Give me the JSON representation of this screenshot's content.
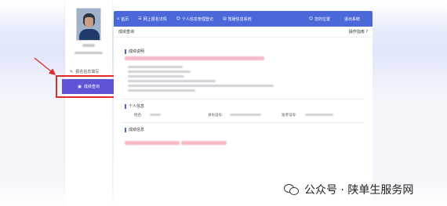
{
  "nav": {
    "items": [
      {
        "icon": "home-icon",
        "glyph": "⌂",
        "label": "首页"
      },
      {
        "icon": "list-icon",
        "glyph": "☰",
        "label": "网上报名详情"
      },
      {
        "icon": "user-icon",
        "glyph": "☺",
        "label": "个人信息管理登记"
      },
      {
        "icon": "doc-icon",
        "glyph": "▤",
        "label": "暂缓信息系统"
      }
    ],
    "right_items": [
      {
        "icon": "person-icon",
        "glyph": "☺",
        "label": "您的位置"
      },
      {
        "label": "退出系统"
      }
    ]
  },
  "sidebar": {
    "link_label": "报名信息填写",
    "active_label": "成绩查询"
  },
  "content": {
    "title": "成绩查询",
    "help": "操作指南 ?",
    "section_result": "成绩说明",
    "section_personal": "个人信息",
    "section_scores": "成绩信息",
    "fields": [
      {
        "label": "姓名:"
      },
      {
        "label": "身份证号:"
      },
      {
        "label": "准考证号:"
      }
    ]
  },
  "watermark": {
    "text": "公众号 · 陕单生服务网"
  },
  "colors": {
    "nav_blue": "#4b68d8",
    "active_purple": "#5f54d6",
    "highlight_red": "#e02b2b",
    "blur_pink": "#f6b8c6"
  }
}
